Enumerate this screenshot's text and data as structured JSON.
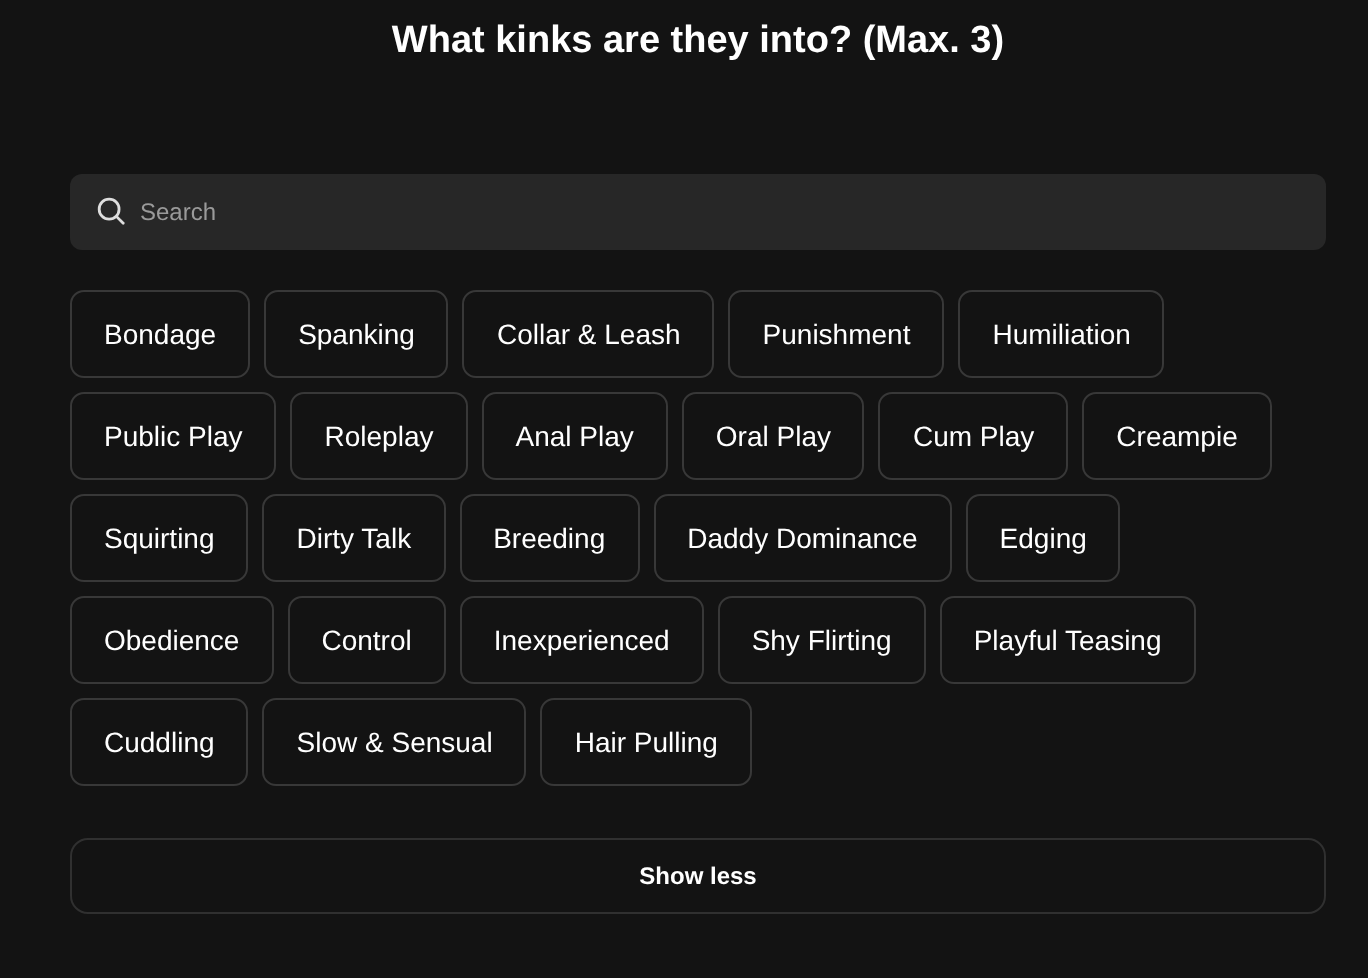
{
  "title": "What kinks are they into? (Max. 3)",
  "search": {
    "placeholder": "Search"
  },
  "tag_rows": [
    [
      {
        "label": "Bondage",
        "selected": false
      },
      {
        "label": "Spanking",
        "selected": false
      },
      {
        "label": "Collar & Leash",
        "selected": false
      },
      {
        "label": "Punishment",
        "selected": false
      },
      {
        "label": "Humiliation",
        "selected": false
      }
    ],
    [
      {
        "label": "Public Play",
        "selected": false
      },
      {
        "label": "Roleplay",
        "selected": false
      },
      {
        "label": "Anal Play",
        "selected": false
      },
      {
        "label": "Oral Play",
        "selected": false
      },
      {
        "label": "Cum Play",
        "selected": false
      },
      {
        "label": "Creampie",
        "selected": false
      }
    ],
    [
      {
        "label": "Squirting",
        "selected": false
      },
      {
        "label": "Dirty Talk",
        "selected": false
      },
      {
        "label": "Breeding",
        "selected": false
      },
      {
        "label": "Daddy Dominance",
        "selected": false
      },
      {
        "label": "Edging",
        "selected": false
      }
    ],
    [
      {
        "label": "Obedience",
        "selected": false
      },
      {
        "label": "Control",
        "selected": false
      },
      {
        "label": "Inexperienced",
        "selected": false
      },
      {
        "label": "Shy Flirting",
        "selected": false
      },
      {
        "label": "Playful Teasing",
        "selected": false
      }
    ],
    [
      {
        "label": "Cuddling",
        "selected": false
      },
      {
        "label": "Slow & Sensual",
        "selected": false
      },
      {
        "label": "Hair Pulling",
        "selected": false
      }
    ]
  ],
  "toggle_button": "Show less"
}
